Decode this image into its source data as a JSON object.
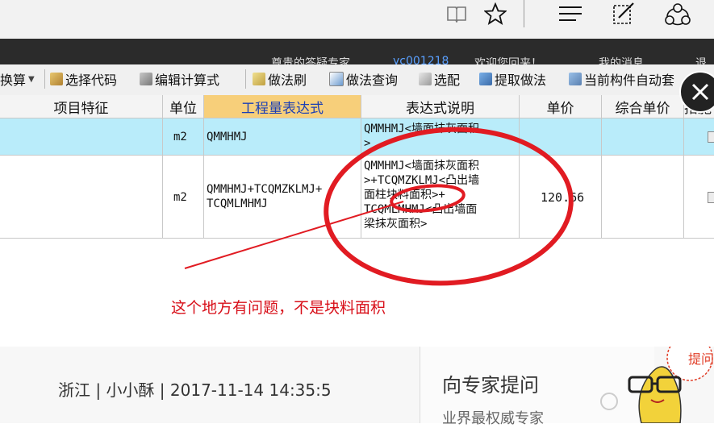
{
  "browser": {
    "icons": [
      "reading-view-icon",
      "favorite-star-icon",
      "hub-icon",
      "web-note-icon",
      "share-icon"
    ]
  },
  "site_nav": {
    "text1": "尊贵的答疑专家",
    "text2": "yc001218",
    "text3": "欢迎您回来！",
    "text4": "我的消息",
    "text5": "退"
  },
  "toolbar": {
    "items": [
      {
        "label": "换算"
      },
      {
        "label": "选择代码"
      },
      {
        "label": "编辑计算式"
      },
      {
        "label": "做法刷"
      },
      {
        "label": "做法查询"
      },
      {
        "label": "选配"
      },
      {
        "label": "提取做法"
      },
      {
        "label": "当前构件自动套"
      }
    ]
  },
  "table": {
    "headers": [
      "项目特征",
      "单位",
      "工程量表达式",
      "表达式说明",
      "单价",
      "综合单价",
      "措施"
    ],
    "rows": [
      {
        "unit": "m2",
        "expr": "QMMHMJ",
        "desc_lines": [
          "QMMHMJ<墙面抹灰面积",
          ">"
        ],
        "price": ""
      },
      {
        "unit": "m2",
        "expr_lines": [
          "QMMHMJ+TCQMZKLMJ+",
          "TCQMLMHMJ"
        ],
        "desc_lines": [
          "QMMHMJ<墙面抹灰面积",
          ">+TCQMZKLMJ<凸出墙",
          "面柱块料面积>+",
          "TCQMLMHMJ<凸出墙面",
          "梁抹灰面积>"
        ],
        "price": "120.66"
      }
    ]
  },
  "annotation": {
    "text": "这个地方有问题，不是块料面积",
    "color": "#d8101a"
  },
  "bottom": {
    "meta": "浙江 | 小小酥 | 2017-11-14 14:35:5",
    "expert_title": "向专家提问",
    "expert_sub": "业界最权威专家",
    "mascot_badge": "提问"
  }
}
